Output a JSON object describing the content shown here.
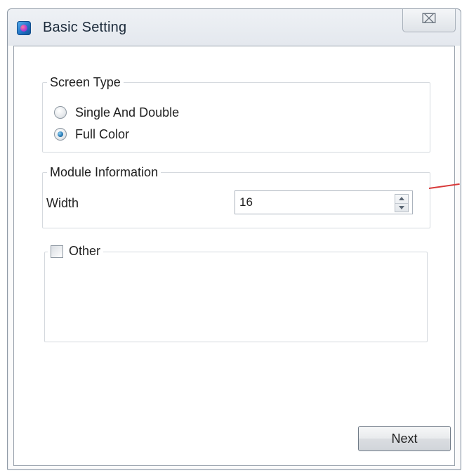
{
  "window": {
    "title": "Basic Setting",
    "app_icon": "app-logo-icon",
    "close_glyph": "⌧",
    "close_icon": "close-icon"
  },
  "screen_type": {
    "title": "Screen Type",
    "options": [
      {
        "label": "Single And Double",
        "selected": false
      },
      {
        "label": "Full Color",
        "selected": true
      }
    ]
  },
  "module_information": {
    "title": "Module Information",
    "width_label": "Width",
    "width_value": "16"
  },
  "other": {
    "label": "Other",
    "checked": false
  },
  "footer": {
    "next_label": "Next"
  },
  "colors": {
    "accent": "#2a7db8",
    "annotation_line": "#d83a3a"
  }
}
